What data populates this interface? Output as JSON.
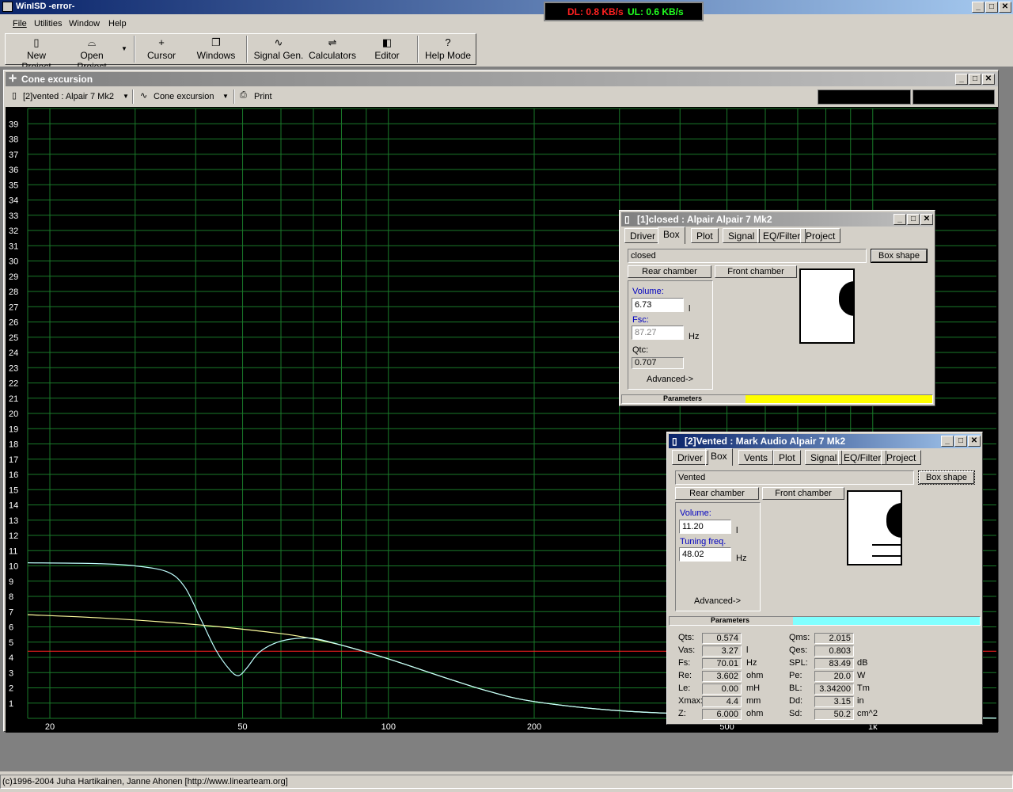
{
  "app": {
    "title": "WinISD -error-",
    "menu": [
      "File",
      "Utilities",
      "Window",
      "Help"
    ],
    "toolbar": [
      {
        "label": "New Project",
        "icon": "new-project-icon"
      },
      {
        "label": "Open Project",
        "icon": "open-project-icon"
      },
      {
        "label": "Cursor",
        "icon": "cursor-icon"
      },
      {
        "label": "Windows",
        "icon": "windows-icon"
      },
      {
        "label": "Signal Gen.",
        "icon": "signal-gen-icon"
      },
      {
        "label": "Calculators",
        "icon": "calculators-icon"
      },
      {
        "label": "Editor",
        "icon": "editor-icon"
      },
      {
        "label": "Help Mode",
        "icon": "help-mode-icon"
      }
    ],
    "status": "(c)1996-2004 Juha Hartikainen, Janne Ahonen [http://www.linearteam.org]"
  },
  "speed": {
    "dl": "DL: 0.8 KB/s",
    "ul": "UL: 0.6 KB/s",
    "dl_color": "#ff2020",
    "ul_color": "#20ff20"
  },
  "graph_window": {
    "title": "Cone excursion",
    "project_select": "[2]vented : Alpair 7 Mk2",
    "graph_select": "Cone excursion",
    "print_label": "Print"
  },
  "closed_window": {
    "title": "[1]closed : Alpair Alpair 7 Mk2",
    "tabs": [
      "Driver",
      "Box",
      "Plot",
      "Signal",
      "EQ/Filter",
      "Project"
    ],
    "box_name": "closed",
    "box_shape_label": "Box shape",
    "rear_chamber": "Rear chamber",
    "front_chamber": "Front chamber",
    "volume_label": "Volume:",
    "volume_value": "6.73",
    "volume_unit": "l",
    "fsc_label": "Fsc:",
    "fsc_value": "87.27",
    "fsc_unit": "Hz",
    "qtc_label": "Qtc:",
    "qtc_value": "0.707",
    "advanced": "Advanced->",
    "parameters": "Parameters",
    "param_color": "#ffff00"
  },
  "vented_window": {
    "title": "[2]Vented : Mark Audio Alpair 7 Mk2",
    "tabs": [
      "Driver",
      "Box",
      "Vents",
      "Plot",
      "Signal",
      "EQ/Filter",
      "Project"
    ],
    "box_name": "Vented",
    "box_shape_label": "Box shape",
    "rear_chamber": "Rear chamber",
    "front_chamber": "Front chamber",
    "volume_label": "Volume:",
    "volume_value": "11.20",
    "volume_unit": "l",
    "tuning_label": "Tuning freq.",
    "tuning_value": "48.02",
    "tuning_unit": "Hz",
    "advanced": "Advanced->",
    "parameters": "Parameters",
    "param_color": "#80ffff",
    "params_left": [
      {
        "label": "Qts:",
        "value": "0.574",
        "unit": ""
      },
      {
        "label": "Vas:",
        "value": "3.27",
        "unit": "l"
      },
      {
        "label": "Fs:",
        "value": "70.01",
        "unit": "Hz"
      },
      {
        "label": "Re:",
        "value": "3.602",
        "unit": "ohm"
      },
      {
        "label": "Le:",
        "value": "0.00",
        "unit": "mH"
      },
      {
        "label": "Xmax:",
        "value": "4.4",
        "unit": "mm"
      },
      {
        "label": "Z:",
        "value": "6.000",
        "unit": "ohm"
      }
    ],
    "params_right": [
      {
        "label": "Qms:",
        "value": "2.015",
        "unit": ""
      },
      {
        "label": "Qes:",
        "value": "0.803",
        "unit": ""
      },
      {
        "label": "SPL:",
        "value": "83.49",
        "unit": "dB"
      },
      {
        "label": "Pe:",
        "value": "20.0",
        "unit": "W"
      },
      {
        "label": "BL:",
        "value": "3.34200",
        "unit": "Tm"
      },
      {
        "label": "Dd:",
        "value": "3.15",
        "unit": "in"
      },
      {
        "label": "Sd:",
        "value": "50.2",
        "unit": "cm^2"
      }
    ]
  },
  "chart_data": {
    "type": "line",
    "x_scale": "log",
    "xlim": [
      18,
      1800
    ],
    "ylim": [
      0,
      40
    ],
    "y_ticks": [
      1,
      2,
      3,
      4,
      5,
      6,
      7,
      8,
      9,
      10,
      11,
      12,
      13,
      14,
      15,
      16,
      17,
      18,
      19,
      20,
      21,
      22,
      23,
      24,
      25,
      26,
      27,
      28,
      29,
      30,
      31,
      32,
      33,
      34,
      35,
      36,
      37,
      38,
      39
    ],
    "x_tick_labels": [
      {
        "value": 20,
        "label": "20"
      },
      {
        "value": 50,
        "label": "50"
      },
      {
        "value": 100,
        "label": "100"
      },
      {
        "value": 200,
        "label": "200"
      },
      {
        "value": 500,
        "label": "500"
      },
      {
        "value": 1000,
        "label": "1k"
      }
    ],
    "grid": true,
    "reference_line": {
      "y": 4.4,
      "color": "#ff2020"
    },
    "series": [
      {
        "color": "#ffffa0",
        "x": [
          18,
          25,
          35,
          45,
          55,
          65,
          80,
          100,
          130,
          160,
          200,
          300,
          500,
          800,
          1200,
          1800
        ],
        "y": [
          6.8,
          6.6,
          6.3,
          6.0,
          5.7,
          5.4,
          4.8,
          3.9,
          2.7,
          1.8,
          1.1,
          0.5,
          0.2,
          0.08,
          0.04,
          0.02
        ]
      },
      {
        "color": "#c0ffff",
        "x": [
          18,
          25,
          30,
          35,
          38,
          41,
          44,
          47,
          49,
          51,
          54,
          58,
          63,
          70,
          80,
          100,
          130,
          160,
          200,
          300,
          500,
          800,
          1200,
          1800
        ],
        "y": [
          10.2,
          10.15,
          10.0,
          9.6,
          8.6,
          6.5,
          4.5,
          3.2,
          2.8,
          3.3,
          4.3,
          4.9,
          5.2,
          5.25,
          4.8,
          3.9,
          2.7,
          1.8,
          1.1,
          0.5,
          0.2,
          0.08,
          0.04,
          0.02
        ]
      }
    ]
  }
}
